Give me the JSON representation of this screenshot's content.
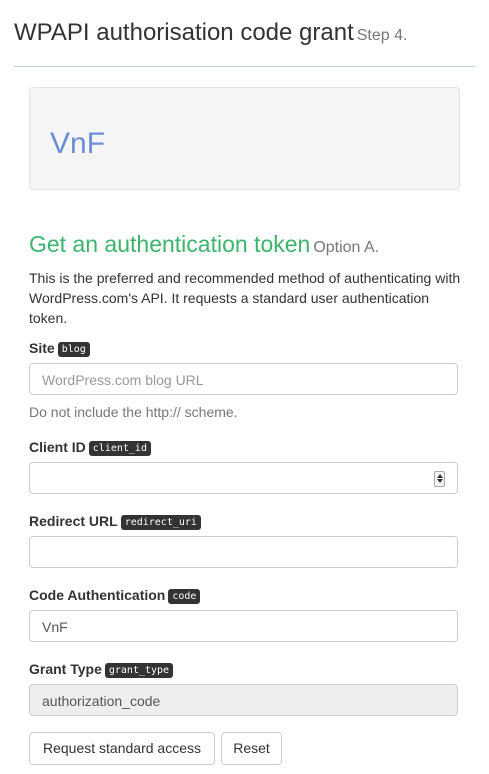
{
  "header": {
    "title": "WPAPI authorisation code grant",
    "step": "Step 4."
  },
  "well": {
    "text": "VnF"
  },
  "section": {
    "title": "Get an authentication token",
    "option": "Option A.",
    "description": "This is the preferred and recommended method of authenticating with WordPress.com's API. It requests a standard user authentication token."
  },
  "form": {
    "site": {
      "label": "Site",
      "tag": "blog",
      "placeholder": "WordPress.com blog URL",
      "value": "",
      "help": "Do not include the http:// scheme."
    },
    "client_id": {
      "label": "Client ID",
      "tag": "client_id",
      "value": ""
    },
    "redirect_url": {
      "label": "Redirect URL",
      "tag": "redirect_uri",
      "value": ""
    },
    "code": {
      "label": "Code Authentication",
      "tag": "code",
      "value": "VnF"
    },
    "grant_type": {
      "label": "Grant Type",
      "tag": "grant_type",
      "value": "authorization_code"
    }
  },
  "buttons": {
    "request": "Request standard access",
    "reset": "Reset"
  },
  "colors": {
    "section_title": "#3cb46b",
    "well_text": "#6a8fd8",
    "code_tag_bg": "#333333",
    "header_rule": "#b9d2da"
  }
}
